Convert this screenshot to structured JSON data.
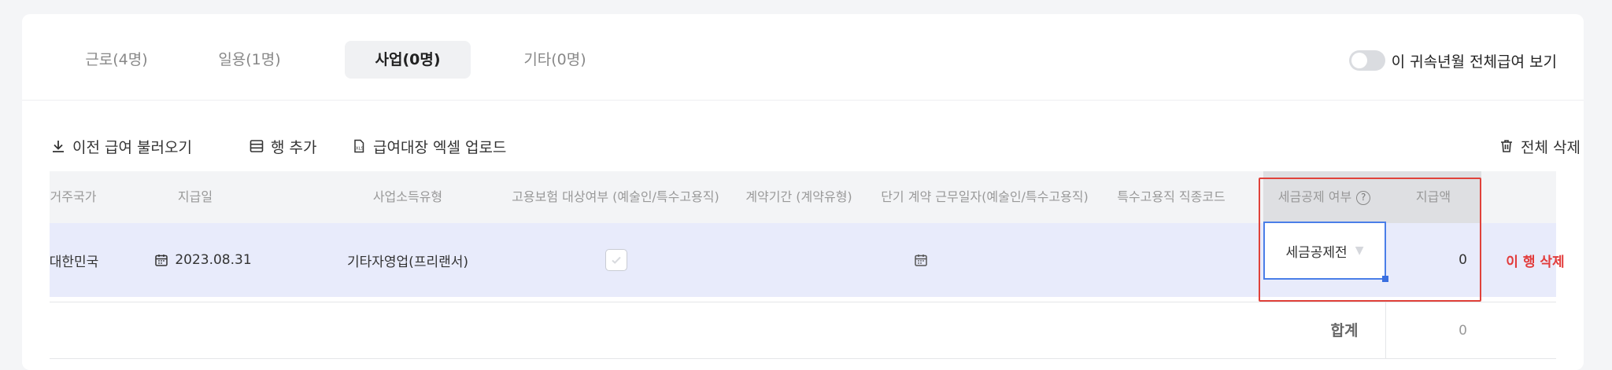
{
  "tabs": [
    {
      "label": "근로(4명)"
    },
    {
      "label": "일용(1명)"
    },
    {
      "label": "사업(0명)"
    },
    {
      "label": "기타(0명)"
    }
  ],
  "toggle": {
    "label": "이 귀속년월 전체급여 보기",
    "on": false
  },
  "toolbar": {
    "load_prev": "이전 급여 불러오기",
    "add_row": "행 추가",
    "excel_upload": "급여대장 엑셀 업로드",
    "delete_all": "전체 삭제"
  },
  "table": {
    "headers": [
      "거주국가",
      "지급일",
      "사업소득유형",
      "고용보험 대상여부 (예술인/특수고용직)",
      "계약기간 (계약유형)",
      "단기 계약 근무일자(예술인/특수고용직)",
      "특수고용직 직종코드",
      "세금공제 여부",
      "지급액"
    ],
    "row": {
      "country": "대한민국",
      "pay_date": "2023.08.31",
      "income_type": "기타자영업(프리랜서)",
      "insurance_checked": true,
      "tax_deduction": "세금공제전",
      "amount": "0",
      "delete_label": "이 행 삭제"
    },
    "summary": {
      "label": "합계",
      "value": "0"
    }
  }
}
